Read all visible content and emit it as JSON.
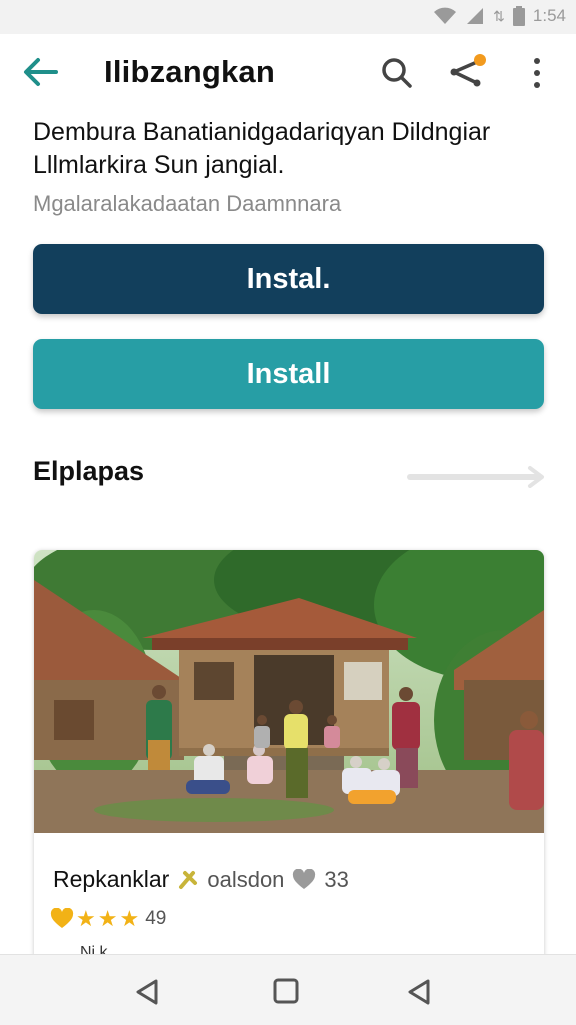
{
  "status_bar": {
    "time": "1:54"
  },
  "app_bar": {
    "title": "Ilibzangkan"
  },
  "content": {
    "headline": "Dembura Banatianidgadariqyan Dildngiar Lllmlarkira Sun jangial.",
    "subline": "Mgalaralakadaatan Daamnnara",
    "buttons": {
      "primary": "Instal.",
      "secondary": "Install"
    }
  },
  "section": {
    "title": "Elplapas"
  },
  "card": {
    "name": "Repkanklar",
    "sub_label": "oalsdon",
    "likes": "33",
    "rating": "49",
    "extra_text": "Ni k"
  },
  "colors": {
    "accent_teal": "#279ea5",
    "primary_navy": "#123f5c",
    "back_arrow": "#1f8f8a",
    "badge_orange": "#f29a1e",
    "star_yellow": "#f2b216"
  },
  "icons": {
    "back": "arrow-left-icon",
    "search": "search-icon",
    "share": "share-icon",
    "more": "more-vertical-icon",
    "bookmark": "bookmark-icon",
    "heart": "heart-icon",
    "star": "star-icon"
  }
}
